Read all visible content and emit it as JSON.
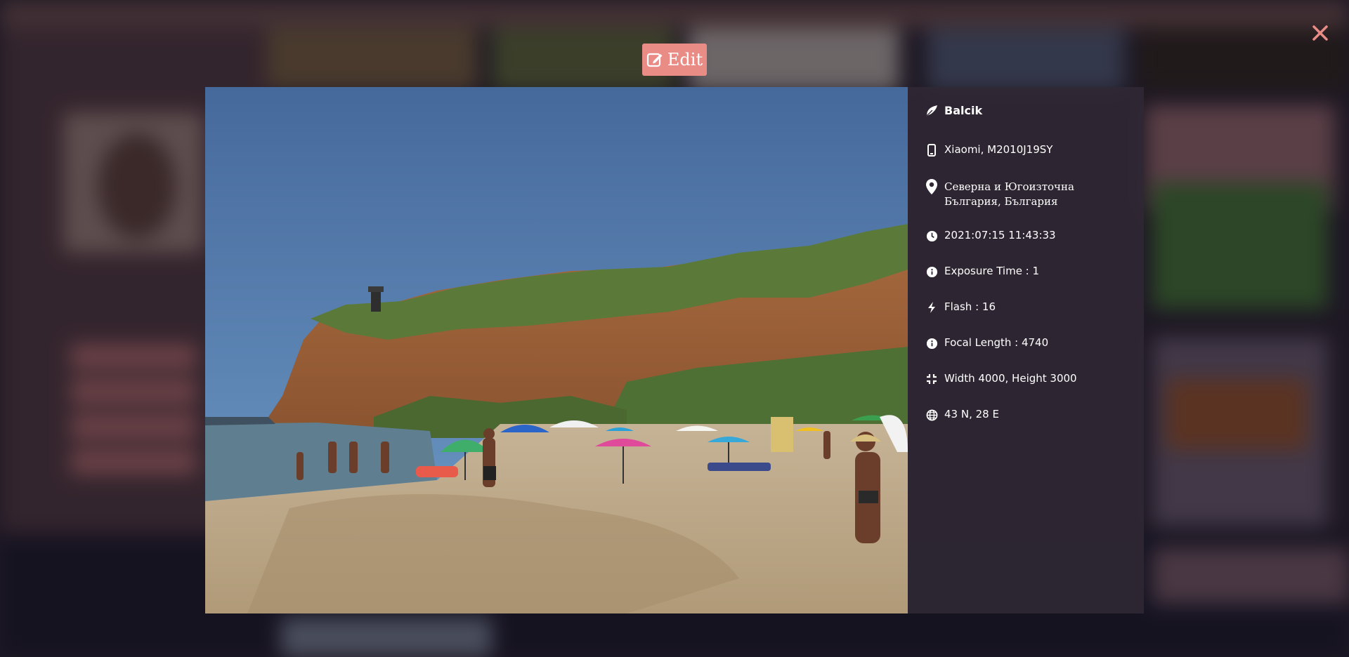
{
  "lightbox": {
    "edit_label": "Edit",
    "close_icon": "close-icon",
    "accent_color": "#e98c86"
  },
  "info": {
    "title": "Balcik",
    "device": "Xiaomi, M2010J19SY",
    "location": "Северна и Югоизточна България, България",
    "datetime": "2021:07:15 11:43:33",
    "exposure": "Exposure Time : 1",
    "flash": "Flash : 16",
    "focal_length": "Focal Length : 4740",
    "dimensions": "Width 4000, Height 3000",
    "coordinates": "43 N, 28 E",
    "icons": [
      "feather-icon",
      "mobile-icon",
      "map-pin-icon",
      "clock-icon",
      "info-icon",
      "bolt-icon",
      "info-icon",
      "compress-icon",
      "globe-icon"
    ]
  }
}
